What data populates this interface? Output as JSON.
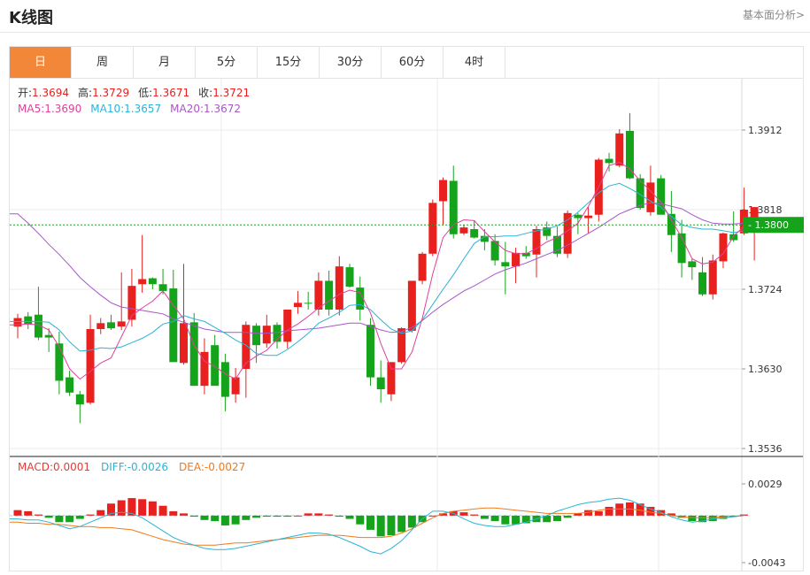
{
  "header": {
    "title": "K线图",
    "link": "基本面分析>"
  },
  "tabs": [
    "日",
    "周",
    "月",
    "5分",
    "15分",
    "30分",
    "60分",
    "4时"
  ],
  "active_tab": 0,
  "info": {
    "ohlc": [
      {
        "label": "开:",
        "value": "1.3694"
      },
      {
        "label": "高:",
        "value": "1.3729"
      },
      {
        "label": "低:",
        "value": "1.3671"
      },
      {
        "label": "收:",
        "value": "1.3721"
      }
    ],
    "ma": [
      {
        "label": "MA5:",
        "value": "1.3690",
        "color": "#e0409a"
      },
      {
        "label": "MA10:",
        "value": "1.3657",
        "color": "#2ab4d4"
      },
      {
        "label": "MA20:",
        "value": "1.3672",
        "color": "#a855c8"
      }
    ]
  },
  "macd_info": [
    {
      "label": "MACD:",
      "value": "0.0001",
      "color": "#e43b36"
    },
    {
      "label": "DIFF:",
      "value": "-0.0026",
      "color": "#2ab4d4"
    },
    {
      "label": "DEA:",
      "value": "-0.0027",
      "color": "#f07a1c"
    }
  ],
  "colors": {
    "up": "#e8201e",
    "down": "#16a31c",
    "accent": "#f2873a",
    "grid": "#ebebeb",
    "current": "#16a31c"
  },
  "chart_data": [
    {
      "type": "candlestick",
      "y_ticks": [
        "1.3912",
        "1.3818",
        "1.3724",
        "1.3630",
        "1.3536"
      ],
      "ylim": [
        1.3536,
        1.3912
      ],
      "current_price": "1.3800",
      "candles": [
        [
          1.368,
          1.3695,
          1.3666,
          1.369
        ],
        [
          1.3692,
          1.3697,
          1.3677,
          1.3683
        ],
        [
          1.3694,
          1.3727,
          1.3664,
          1.3667
        ],
        [
          1.367,
          1.3678,
          1.365,
          1.3667
        ],
        [
          1.366,
          1.3674,
          1.36,
          1.3616
        ],
        [
          1.362,
          1.3628,
          1.3598,
          1.3602
        ],
        [
          1.36,
          1.3604,
          1.3566,
          1.3588
        ],
        [
          1.359,
          1.3694,
          1.3588,
          1.3677
        ],
        [
          1.3677,
          1.369,
          1.3671,
          1.3684
        ],
        [
          1.3685,
          1.3694,
          1.3676,
          1.3678
        ],
        [
          1.368,
          1.3744,
          1.3676,
          1.3686
        ],
        [
          1.3688,
          1.3748,
          1.368,
          1.3728
        ],
        [
          1.373,
          1.3788,
          1.372,
          1.3736
        ],
        [
          1.3737,
          1.3738,
          1.3724,
          1.373
        ],
        [
          1.373,
          1.3748,
          1.3718,
          1.3722
        ],
        [
          1.3725,
          1.3747,
          1.364,
          1.3638
        ],
        [
          1.3637,
          1.3754,
          1.3635,
          1.3684
        ],
        [
          1.3685,
          1.3696,
          1.3616,
          1.361
        ],
        [
          1.361,
          1.3666,
          1.36,
          1.365
        ],
        [
          1.3658,
          1.367,
          1.362,
          1.361
        ],
        [
          1.3638,
          1.3648,
          1.358,
          1.3597
        ],
        [
          1.36,
          1.3631,
          1.359,
          1.362
        ],
        [
          1.363,
          1.3686,
          1.3596,
          1.3682
        ],
        [
          1.3681,
          1.3684,
          1.3637,
          1.3658
        ],
        [
          1.366,
          1.3694,
          1.3655,
          1.3681
        ],
        [
          1.3682,
          1.3685,
          1.3654,
          1.3662
        ],
        [
          1.3662,
          1.37,
          1.3654,
          1.37
        ],
        [
          1.3703,
          1.3722,
          1.3695,
          1.3708
        ],
        [
          1.3708,
          1.3721,
          1.37,
          1.3707
        ],
        [
          1.37,
          1.3744,
          1.3693,
          1.3734
        ],
        [
          1.3734,
          1.3746,
          1.3693,
          1.37
        ],
        [
          1.37,
          1.3763,
          1.3693,
          1.3751
        ],
        [
          1.375,
          1.3754,
          1.3726,
          1.3727
        ],
        [
          1.3726,
          1.3739,
          1.3687,
          1.37
        ],
        [
          1.3682,
          1.369,
          1.361,
          1.362
        ],
        [
          1.362,
          1.364,
          1.359,
          1.3606
        ],
        [
          1.36,
          1.3638,
          1.3592,
          1.3638
        ],
        [
          1.3638,
          1.3679,
          1.3636,
          1.3678
        ],
        [
          1.3675,
          1.372,
          1.3673,
          1.3734
        ],
        [
          1.3734,
          1.3768,
          1.373,
          1.3766
        ],
        [
          1.3766,
          1.383,
          1.3763,
          1.3826
        ],
        [
          1.3828,
          1.3856,
          1.38,
          1.3853
        ],
        [
          1.3852,
          1.387,
          1.3784,
          1.3789
        ],
        [
          1.379,
          1.38,
          1.3788,
          1.3797
        ],
        [
          1.3795,
          1.3805,
          1.3784,
          1.3785
        ],
        [
          1.3787,
          1.3795,
          1.377,
          1.378
        ],
        [
          1.3781,
          1.3789,
          1.3752,
          1.3758
        ],
        [
          1.3756,
          1.378,
          1.3718,
          1.3751
        ],
        [
          1.3751,
          1.3773,
          1.3731,
          1.3767
        ],
        [
          1.3767,
          1.3775,
          1.376,
          1.3763
        ],
        [
          1.3765,
          1.3799,
          1.3738,
          1.3795
        ],
        [
          1.3797,
          1.3804,
          1.3782,
          1.3787
        ],
        [
          1.3787,
          1.3798,
          1.3762,
          1.3766
        ],
        [
          1.3766,
          1.3817,
          1.3761,
          1.3814
        ],
        [
          1.3812,
          1.3814,
          1.3789,
          1.3808
        ],
        [
          1.3808,
          1.3821,
          1.379,
          1.3811
        ],
        [
          1.3812,
          1.3879,
          1.3804,
          1.3877
        ],
        [
          1.3878,
          1.3885,
          1.3863,
          1.3873
        ],
        [
          1.387,
          1.3913,
          1.3868,
          1.3908
        ],
        [
          1.3911,
          1.3932,
          1.3854,
          1.3855
        ],
        [
          1.3855,
          1.386,
          1.3818,
          1.382
        ],
        [
          1.3815,
          1.387,
          1.3811,
          1.385
        ],
        [
          1.3855,
          1.3859,
          1.3814,
          1.3812
        ],
        [
          1.3813,
          1.384,
          1.3768,
          1.3788
        ],
        [
          1.379,
          1.3806,
          1.3738,
          1.3755
        ],
        [
          1.3757,
          1.376,
          1.3735,
          1.375
        ],
        [
          1.3744,
          1.3762,
          1.3716,
          1.3718
        ],
        [
          1.3718,
          1.3765,
          1.3712,
          1.3758
        ],
        [
          1.3757,
          1.3791,
          1.3749,
          1.379
        ],
        [
          1.3789,
          1.3816,
          1.378,
          1.3782
        ],
        [
          1.379,
          1.3844,
          1.3788,
          1.3818
        ],
        [
          1.3798,
          1.3821,
          1.3758,
          1.3821
        ]
      ],
      "ma5": [
        1.3682,
        1.3683,
        1.3682,
        1.3676,
        1.3656,
        1.363,
        1.3618,
        1.3627,
        1.3637,
        1.3643,
        1.3668,
        1.3693,
        1.3702,
        1.371,
        1.3722,
        1.3705,
        1.3689,
        1.3658,
        1.3639,
        1.3633,
        1.3624,
        1.3618,
        1.3637,
        1.3645,
        1.3652,
        1.3665,
        1.3676,
        1.3683,
        1.3692,
        1.3702,
        1.371,
        1.3718,
        1.3723,
        1.372,
        1.3696,
        1.366,
        1.363,
        1.363,
        1.365,
        1.369,
        1.3742,
        1.3785,
        1.38,
        1.3806,
        1.3805,
        1.3792,
        1.378,
        1.377,
        1.3766,
        1.3766,
        1.3772,
        1.378,
        1.3785,
        1.3793,
        1.3802,
        1.3822,
        1.3845,
        1.387,
        1.3874,
        1.3866,
        1.3852,
        1.384,
        1.3827,
        1.3806,
        1.3785,
        1.376,
        1.3754,
        1.3756,
        1.3766,
        1.3787,
        1.3798
      ],
      "ma10": [
        1.3686,
        1.3686,
        1.3686,
        1.3685,
        1.3676,
        1.3662,
        1.3651,
        1.3652,
        1.3655,
        1.3654,
        1.3656,
        1.3661,
        1.3666,
        1.3673,
        1.3683,
        1.3686,
        1.3693,
        1.3689,
        1.3686,
        1.3679,
        1.3672,
        1.3664,
        1.3658,
        1.3648,
        1.3646,
        1.3646,
        1.3653,
        1.3662,
        1.3672,
        1.3684,
        1.369,
        1.3697,
        1.3705,
        1.3706,
        1.37,
        1.3688,
        1.3677,
        1.3672,
        1.3675,
        1.3688,
        1.3706,
        1.3724,
        1.3741,
        1.376,
        1.3778,
        1.3786,
        1.3786,
        1.3787,
        1.3787,
        1.379,
        1.3793,
        1.3795,
        1.3799,
        1.3806,
        1.3815,
        1.3826,
        1.3838,
        1.3846,
        1.3849,
        1.3843,
        1.3836,
        1.3828,
        1.3821,
        1.381,
        1.38,
        1.3797,
        1.3795,
        1.3795,
        1.3793,
        1.3791,
        1.3793
      ],
      "ma20": [
        1.3813,
        1.3802,
        1.379,
        1.3777,
        1.3765,
        1.3752,
        1.3738,
        1.3727,
        1.3717,
        1.3708,
        1.3703,
        1.3701,
        1.3699,
        1.3697,
        1.3695,
        1.3689,
        1.3685,
        1.3681,
        1.3677,
        1.3675,
        1.3673,
        1.3673,
        1.3673,
        1.3672,
        1.3672,
        1.3673,
        1.3675,
        1.3676,
        1.3677,
        1.3678,
        1.368,
        1.3682,
        1.3684,
        1.3684,
        1.368,
        1.3676,
        1.3673,
        1.3674,
        1.3679,
        1.3687,
        1.3697,
        1.3706,
        1.3714,
        1.3722,
        1.3728,
        1.3735,
        1.3742,
        1.3747,
        1.3751,
        1.3755,
        1.376,
        1.3765,
        1.377,
        1.3776,
        1.3783,
        1.379,
        1.3797,
        1.3805,
        1.3813,
        1.3818,
        1.3823,
        1.3826,
        1.3825,
        1.3822,
        1.3819,
        1.3812,
        1.3806,
        1.3802,
        1.3801,
        1.3801,
        1.3802
      ]
    },
    {
      "type": "macd",
      "y_ticks": [
        "0.0029",
        "-0.0043"
      ],
      "ylim": [
        -0.0043,
        0.0029
      ],
      "macd": [
        0.0005,
        0.0004,
        0.0001,
        -0.0002,
        -0.0006,
        -0.0006,
        -0.0003,
        0.0001,
        0.0005,
        0.0011,
        0.0014,
        0.0016,
        0.0015,
        0.0013,
        0.0009,
        0.0004,
        0.0002,
        -0.0001,
        -0.0004,
        -0.0005,
        -0.0009,
        -0.0008,
        -0.0004,
        -0.0002,
        -0.0001,
        -0.0001,
        -0.0001,
        0.0,
        0.0002,
        0.0002,
        0.0001,
        -0.0001,
        -0.0003,
        -0.0008,
        -0.0013,
        -0.0019,
        -0.0018,
        -0.0015,
        -0.0011,
        -0.0006,
        0.0,
        0.0002,
        0.0004,
        0.0003,
        0.0001,
        -0.0003,
        -0.0005,
        -0.0008,
        -0.0008,
        -0.0007,
        -0.0006,
        -0.0006,
        -0.0005,
        -0.0002,
        0.0002,
        0.0005,
        0.0004,
        0.0008,
        0.0011,
        0.0012,
        0.0011,
        0.0008,
        0.0005,
        0.0002,
        -0.0002,
        -0.0005,
        -0.0006,
        -0.0005,
        -0.0003,
        -0.0001,
        0.0001
      ],
      "diff": [
        -0.0003,
        -0.0004,
        -0.0004,
        -0.0006,
        -0.0009,
        -0.0012,
        -0.001,
        -0.0006,
        -0.0002,
        0.0002,
        0.0003,
        0.0002,
        -0.0002,
        -0.0008,
        -0.0014,
        -0.002,
        -0.0024,
        -0.0027,
        -0.003,
        -0.0031,
        -0.0031,
        -0.003,
        -0.0028,
        -0.0026,
        -0.0024,
        -0.0022,
        -0.002,
        -0.0018,
        -0.0016,
        -0.0016,
        -0.0017,
        -0.002,
        -0.0024,
        -0.0028,
        -0.0033,
        -0.0035,
        -0.003,
        -0.0023,
        -0.0013,
        -0.0003,
        0.0004,
        0.0004,
        0.0002,
        -0.0003,
        -0.0007,
        -0.0009,
        -0.001,
        -0.001,
        -0.0008,
        -0.0006,
        -0.0003,
        0.0,
        0.0004,
        0.0007,
        0.001,
        0.0012,
        0.0013,
        0.0015,
        0.0016,
        0.0014,
        0.001,
        0.0006,
        0.0003,
        -0.0001,
        -0.0004,
        -0.0006,
        -0.0005,
        -0.0003,
        -0.0002,
        -0.0001,
        0.0
      ],
      "dea": [
        -0.0006,
        -0.0007,
        -0.0007,
        -0.0008,
        -0.0008,
        -0.0009,
        -0.001,
        -0.001,
        -0.0011,
        -0.0011,
        -0.0012,
        -0.0013,
        -0.0016,
        -0.0019,
        -0.0022,
        -0.0024,
        -0.0026,
        -0.0027,
        -0.0027,
        -0.0027,
        -0.0026,
        -0.0025,
        -0.0025,
        -0.0024,
        -0.0023,
        -0.0022,
        -0.0021,
        -0.002,
        -0.0019,
        -0.0018,
        -0.0018,
        -0.0018,
        -0.0019,
        -0.002,
        -0.002,
        -0.002,
        -0.0019,
        -0.0016,
        -0.0012,
        -0.0007,
        -0.0002,
        0.0002,
        0.0004,
        0.0005,
        0.0006,
        0.0007,
        0.0007,
        0.0006,
        0.0005,
        0.0004,
        0.0003,
        0.0002,
        0.0002,
        0.0002,
        0.0002,
        0.0003,
        0.0005,
        0.0006,
        0.0006,
        0.0006,
        0.0005,
        0.0003,
        0.0002,
        0.0,
        -0.0001,
        -0.0002,
        -0.0002,
        -0.0002,
        -0.0001,
        -0.0001,
        0.0
      ]
    }
  ]
}
